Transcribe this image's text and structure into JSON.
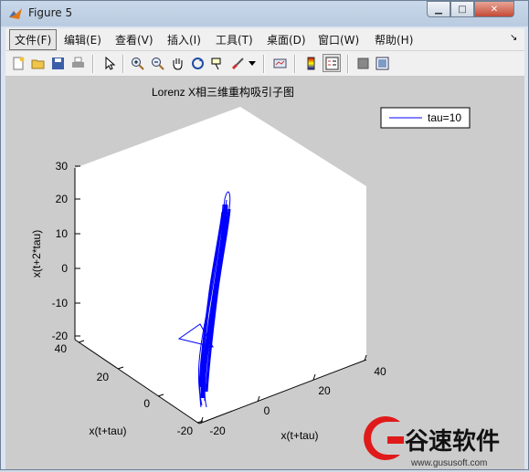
{
  "window": {
    "title": "Figure 5"
  },
  "window_controls": {
    "minimize": "▁",
    "maximize": "□",
    "close": "✕"
  },
  "menu": {
    "items": [
      {
        "label": "文件(F)"
      },
      {
        "label": "编辑(E)"
      },
      {
        "label": "查看(V)"
      },
      {
        "label": "插入(I)"
      },
      {
        "label": "工具(T)"
      },
      {
        "label": "桌面(D)"
      },
      {
        "label": "窗口(W)"
      },
      {
        "label": "帮助(H)"
      }
    ],
    "overflow_glyph": "↘"
  },
  "toolbar": {
    "icons": [
      "new-figure-icon",
      "open-file-icon",
      "save-icon",
      "print-icon",
      "select-arrow-icon",
      "zoom-in-icon",
      "zoom-out-icon",
      "pan-hand-icon",
      "rotate-3d-icon",
      "data-cursor-icon",
      "brush-icon",
      "brush-dropdown-icon",
      "link-plot-icon",
      "colorbar-icon",
      "legend-icon",
      "hide-plot-tools-icon",
      "show-plot-tools-icon"
    ]
  },
  "plot": {
    "title": "Lorenz X相三维重构吸引子图",
    "zlabel": "x(t+2*tau)",
    "ylabel": "x(t+tau)",
    "xlabel": "x(t+tau)",
    "z_ticks": [
      "30",
      "20",
      "10",
      "0",
      "-10",
      "-20"
    ],
    "y_ticks": [
      "40",
      "20",
      "0",
      "-20"
    ],
    "x_ticks": [
      "-20",
      "0",
      "20",
      "40"
    ],
    "legend": "tau=10",
    "line_color": "#0000ff"
  },
  "chart_data": {
    "type": "line",
    "title": "Lorenz X相三维重构吸引子图",
    "xlabel": "x(t+tau)",
    "ylabel": "x(t+tau)",
    "zlabel": "x(t+2*tau)",
    "xlim": [
      -20,
      40
    ],
    "ylim": [
      -20,
      40
    ],
    "zlim": [
      -20,
      30
    ],
    "series": [
      {
        "name": "tau=10",
        "color": "#0000ff"
      }
    ]
  },
  "watermark": {
    "brand": "谷速软件",
    "url": "www.gususoft.com"
  }
}
